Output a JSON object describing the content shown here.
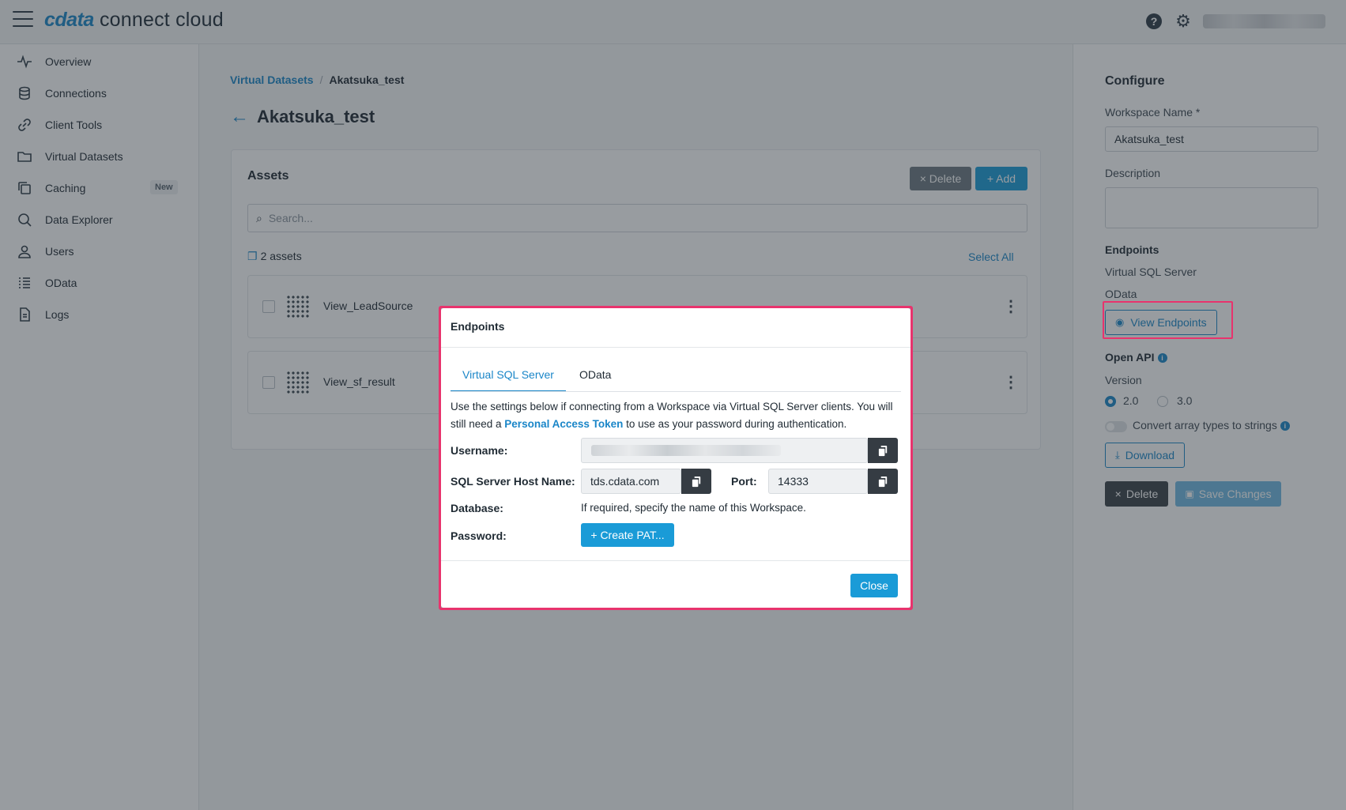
{
  "header": {
    "logo_brand": "cdata",
    "logo_rest": " connect cloud",
    "help_icon": "help-circle-icon",
    "settings_icon": "gear-icon"
  },
  "sidebar": {
    "items": [
      {
        "label": "Overview",
        "icon": "activity-icon"
      },
      {
        "label": "Connections",
        "icon": "database-icon"
      },
      {
        "label": "Client Tools",
        "icon": "link-icon"
      },
      {
        "label": "Virtual Datasets",
        "icon": "folder-icon"
      },
      {
        "label": "Caching",
        "icon": "copy-icon",
        "badge": "New"
      },
      {
        "label": "Data Explorer",
        "icon": "search-icon"
      },
      {
        "label": "Users",
        "icon": "user-icon"
      },
      {
        "label": "OData",
        "icon": "list-icon"
      },
      {
        "label": "Logs",
        "icon": "file-icon"
      }
    ]
  },
  "breadcrumb": {
    "parent": "Virtual Datasets",
    "separator": "/",
    "current": "Akatsuka_test"
  },
  "page": {
    "title": "Akatsuka_test"
  },
  "assets": {
    "title": "Assets",
    "delete_label": "× Delete",
    "add_label": "+ Add",
    "search_placeholder": "Search...",
    "count": "2 assets",
    "select_all": "Select All",
    "rows": [
      {
        "name": "View_LeadSource"
      },
      {
        "name": "View_sf_result"
      }
    ]
  },
  "config": {
    "title": "Configure",
    "workspace_name_label": "Workspace Name *",
    "workspace_name_value": "Akatsuka_test",
    "description_label": "Description",
    "endpoints_label": "Endpoints",
    "endpoint_1": "Virtual SQL Server",
    "endpoint_2": "OData",
    "view_endpoints": "View Endpoints",
    "open_api_label": "Open API",
    "version_label": "Version",
    "version_options": [
      "2.0",
      "3.0"
    ],
    "version_selected": "2.0",
    "convert_label": "Convert array types to strings",
    "convert_enabled": false,
    "download_label": "Download",
    "delete_label": "Delete",
    "save_label": "Save Changes"
  },
  "modal": {
    "title": "Endpoints",
    "tabs": [
      "Virtual SQL Server",
      "OData"
    ],
    "active_tab": "Virtual SQL Server",
    "desc_part1": "Use the settings below if connecting from a Workspace via Virtual SQL Server clients. You will still need a ",
    "desc_link": "Personal Access Token",
    "desc_part2": " to use as your password during authentication.",
    "username_label": "Username:",
    "host_label": "SQL Server Host Name:",
    "host_value": "tds.cdata.com",
    "port_label": "Port:",
    "port_value": "14333",
    "database_label": "Database:",
    "database_text": "If required, specify the name of this Workspace.",
    "password_label": "Password:",
    "create_pat": "+ Create PAT...",
    "close": "Close"
  },
  "colors": {
    "accent": "#1a86c8",
    "highlight": "#e8336d",
    "sidebar_bg": "#ffffff"
  }
}
